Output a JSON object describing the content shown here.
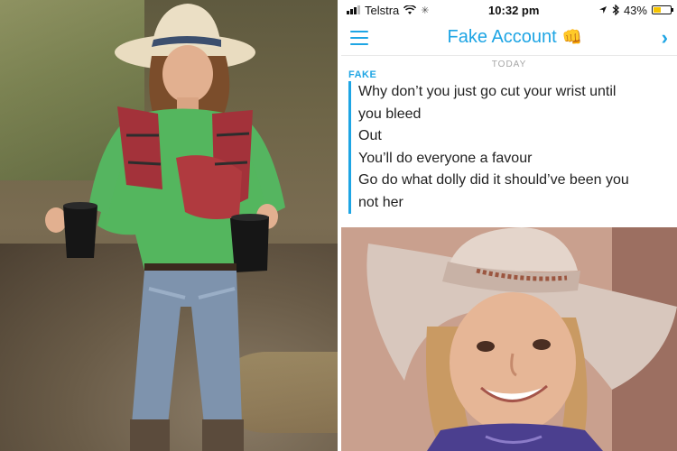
{
  "status_bar": {
    "carrier": "Telstra",
    "time": "10:32 pm",
    "battery": "43%",
    "battery_level": 0.43
  },
  "chat": {
    "title": "Fake Account",
    "title_emoji": "👊",
    "date_label": "TODAY",
    "sender": "FAKE",
    "messages": [
      "Why don’t you just go cut your wrist until",
      "you bleed",
      "Out",
      "You’ll do everyone a favour",
      "Go do what dolly did it should’ve been you",
      "not her"
    ]
  },
  "icons": {
    "menu": "hamburger-icon",
    "next": "chevron-right-icon",
    "wifi": "wifi-icon",
    "location": "location-arrow-icon",
    "bluetooth": "bluetooth-icon"
  },
  "colors": {
    "accent": "#1ea5e4",
    "battery": "#f5c400"
  }
}
